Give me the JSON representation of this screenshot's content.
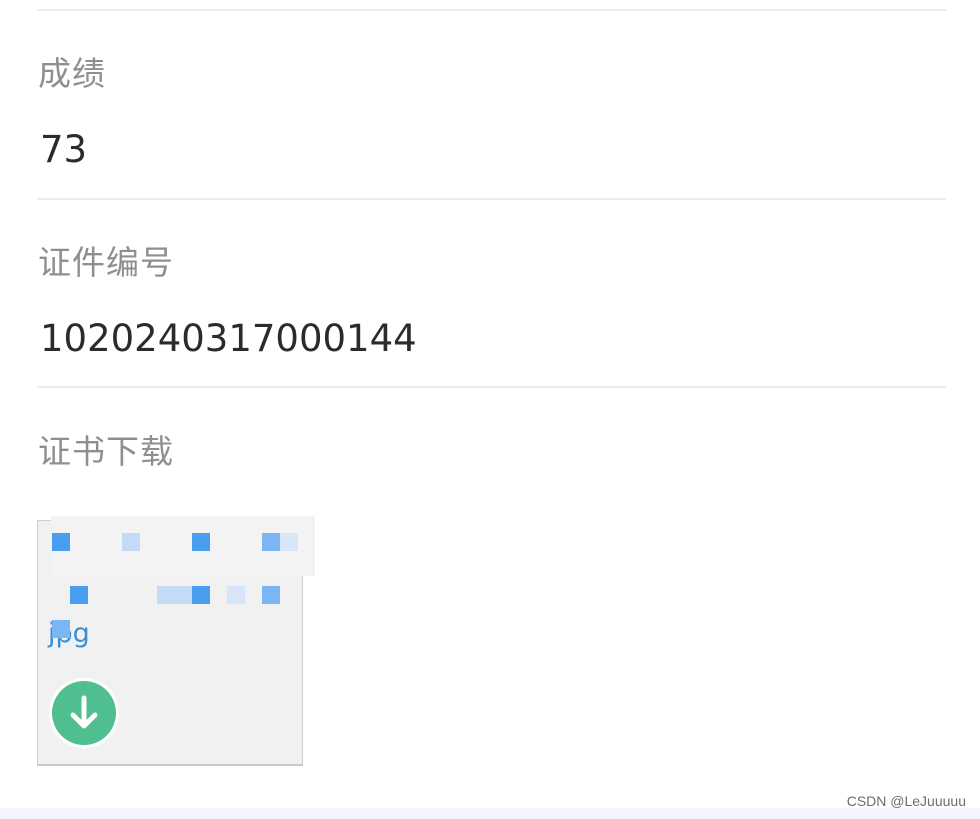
{
  "fields": [
    {
      "label": "成绩",
      "value": "73"
    },
    {
      "label": "证件编号",
      "value": "1020240317000144"
    },
    {
      "label": "证书下载",
      "value": ""
    }
  ],
  "attachment": {
    "extension_text": "jpg",
    "download_icon": "download-arrow-icon"
  },
  "colors": {
    "label": "#8f8f8f",
    "value": "#2b2b2b",
    "divider": "#ececec",
    "download_button": "#4fbf8f",
    "link_blue": "#3a8fd6"
  },
  "watermark": "CSDN @LeJuuuuu"
}
